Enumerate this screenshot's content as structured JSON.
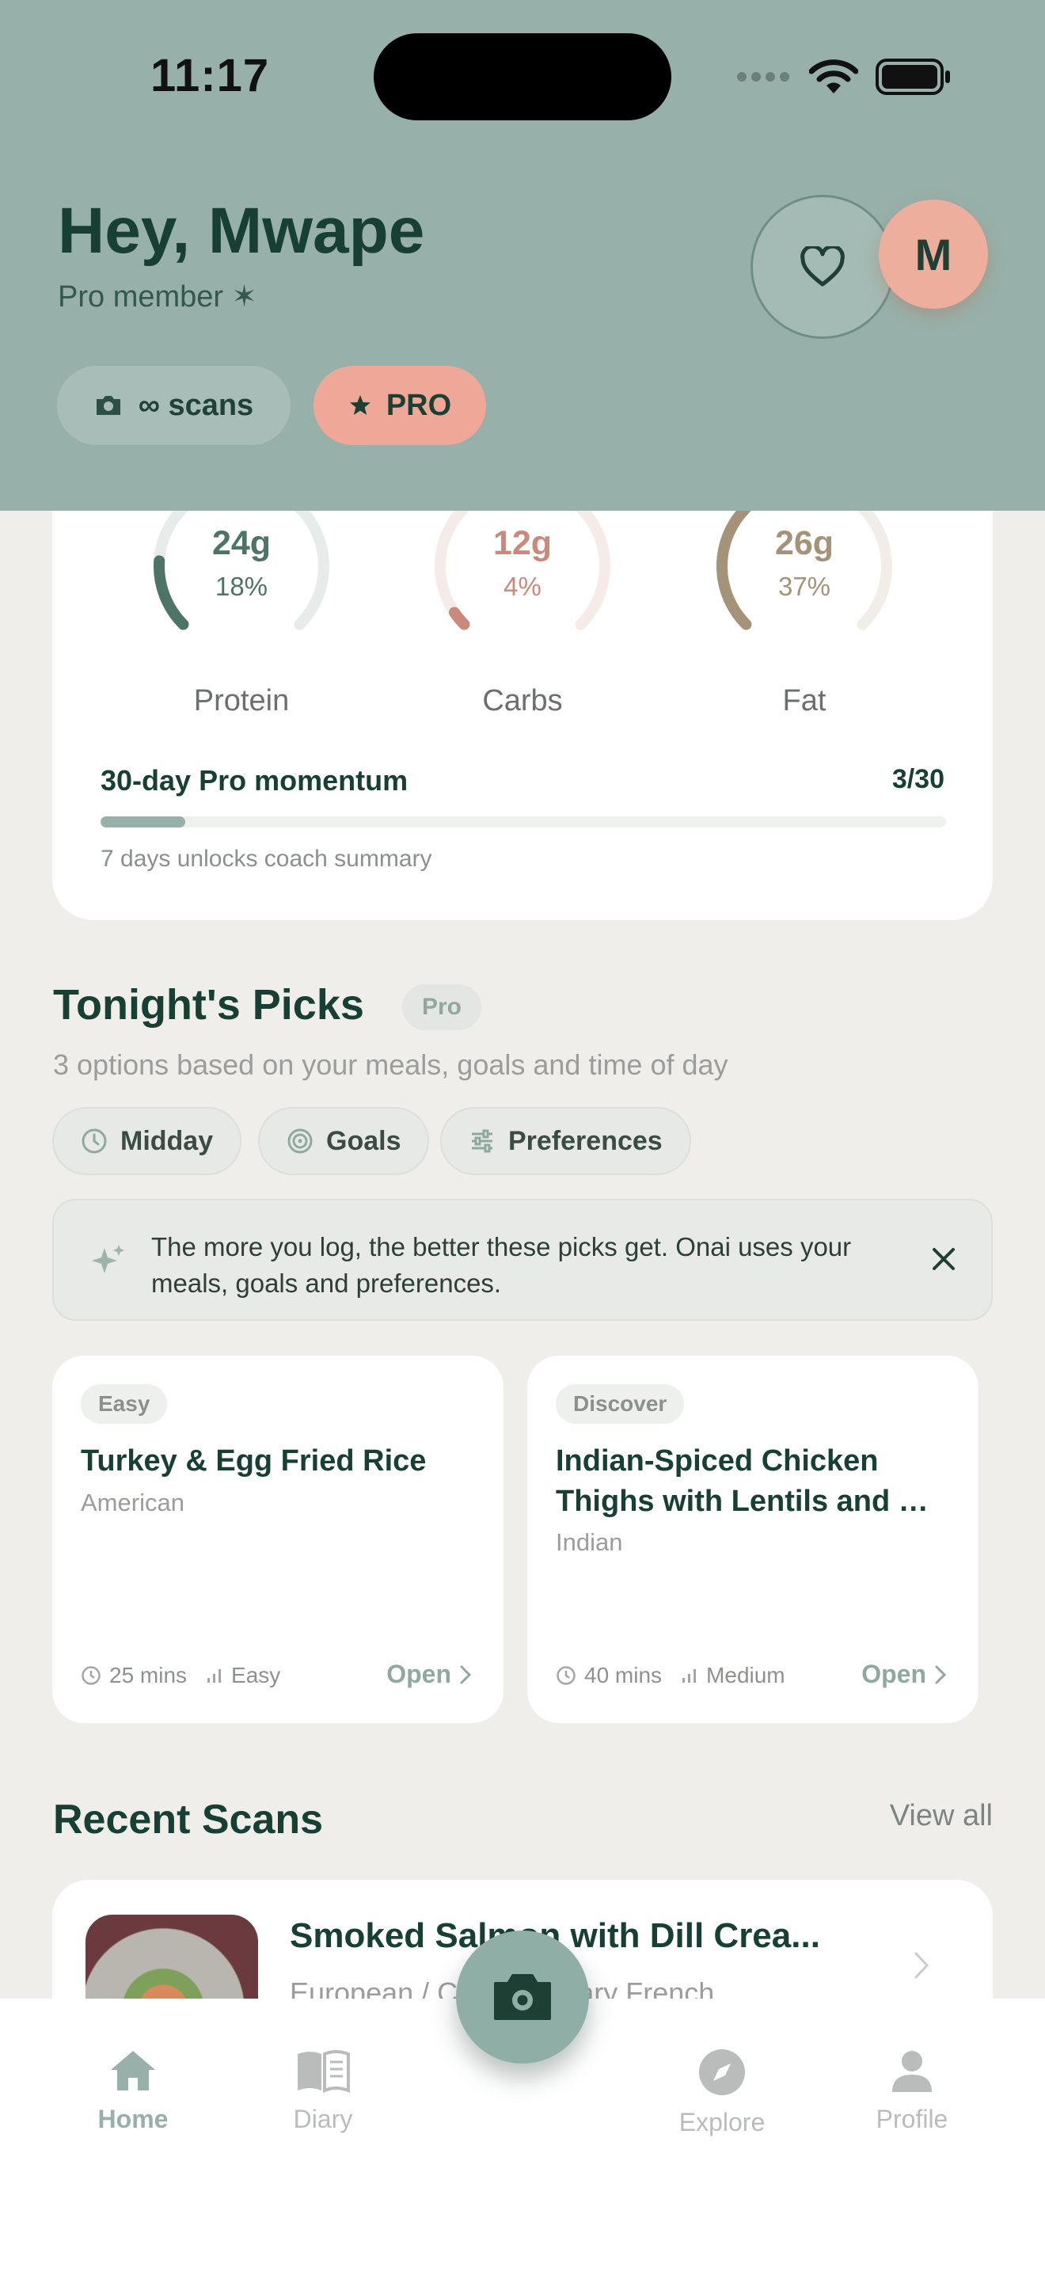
{
  "status_bar": {
    "time": "11:17"
  },
  "header": {
    "greeting": "Hey, Mwape",
    "membership": "Pro member ✶",
    "avatar_initial": "M",
    "scans_chip": "∞ scans",
    "pro_chip": "PRO"
  },
  "macros": [
    {
      "amount": "24g",
      "percent": "18%",
      "label": "Protein",
      "progress": 0.18,
      "color": "#4E7468",
      "track": "#E7ECEA"
    },
    {
      "amount": "12g",
      "percent": "4%",
      "label": "Carbs",
      "progress": 0.04,
      "color": "#C98A7C",
      "track": "#F5ECE9"
    },
    {
      "amount": "26g",
      "percent": "37%",
      "label": "Fat",
      "progress": 0.37,
      "color": "#A59379",
      "track": "#F1EEE9"
    }
  ],
  "momentum": {
    "title": "30-day Pro momentum",
    "count": "3/30",
    "progress": 0.1,
    "note": "7 days unlocks coach summary"
  },
  "picks": {
    "title": "Tonight's Picks",
    "badge": "Pro",
    "subtitle": "3 options based on your meals, goals and time of day",
    "filters": [
      "Midday",
      "Goals",
      "Preferences"
    ],
    "info": "The more you log, the better these picks get. Onai uses your meals, goals and preferences.",
    "cards": [
      {
        "tag": "Easy",
        "title": "Turkey & Egg Fried Rice",
        "cuisine": "American",
        "time": "25 mins",
        "difficulty": "Easy",
        "open": "Open"
      },
      {
        "tag": "Discover",
        "title": "Indian-Spiced Chicken Thighs with Lentils and …",
        "cuisine": "Indian",
        "time": "40 mins",
        "difficulty": "Medium",
        "open": "Open"
      }
    ]
  },
  "recent": {
    "title": "Recent Scans",
    "view_all": "View all",
    "item": {
      "title": "Smoked Salmon with Dill Crea...",
      "subtitle": "European / Contemporary French"
    }
  },
  "tabs": [
    {
      "label": "Home",
      "active": true
    },
    {
      "label": "Diary",
      "active": false
    },
    {
      "label": "Explore",
      "active": false
    },
    {
      "label": "Profile",
      "active": false
    }
  ]
}
